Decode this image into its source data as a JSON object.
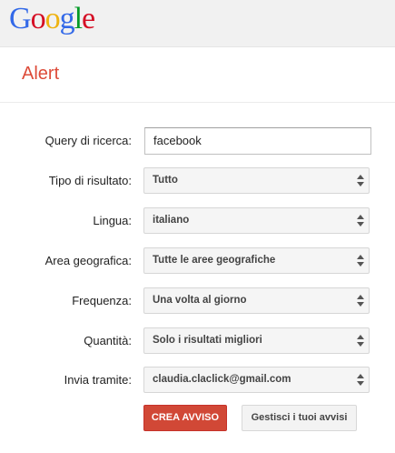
{
  "header": {
    "logo_letters": [
      {
        "char": "G",
        "color": "#3369e8"
      },
      {
        "char": "o",
        "color": "#d50f25"
      },
      {
        "char": "o",
        "color": "#eeb211"
      },
      {
        "char": "g",
        "color": "#3369e8"
      },
      {
        "char": "l",
        "color": "#009925"
      },
      {
        "char": "e",
        "color": "#d50f25"
      }
    ]
  },
  "page": {
    "title": "Alert",
    "title_color": "#dd4b39"
  },
  "form": {
    "query": {
      "label": "Query di ricerca:",
      "value": "facebook"
    },
    "result_type": {
      "label": "Tipo di risultato:",
      "value": "Tutto"
    },
    "language": {
      "label": "Lingua:",
      "value": "italiano"
    },
    "region": {
      "label": "Area geografica:",
      "value": "Tutte le aree geografiche"
    },
    "frequency": {
      "label": "Frequenza:",
      "value": "Una volta al giorno"
    },
    "quantity": {
      "label": "Quantità:",
      "value": "Solo i risultati migliori"
    },
    "deliver_to": {
      "label": "Invia tramite:",
      "value": "claudia.claclick@gmail.com"
    }
  },
  "actions": {
    "create_label": "CREA AVVISO",
    "create_color": "#d14836",
    "manage_label": "Gestisci i tuoi avvisi"
  }
}
